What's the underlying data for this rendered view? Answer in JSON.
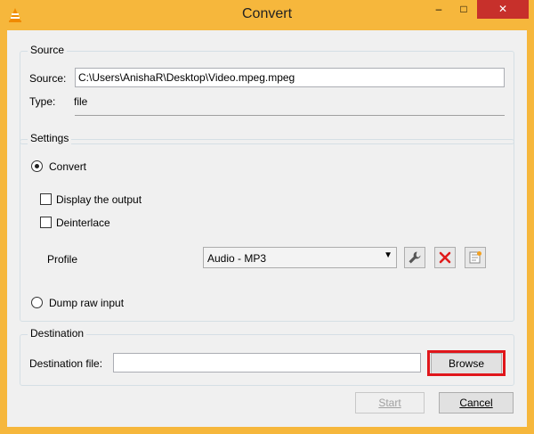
{
  "window": {
    "title": "Convert",
    "minimize_glyph": "–",
    "maximize_glyph": "□",
    "close_glyph": "✕",
    "icon": "vlc-cone-icon"
  },
  "source": {
    "group_title": "Source",
    "source_label": "Source:",
    "source_value": "C:\\Users\\AnishaR\\Desktop\\Video.mpeg.mpeg",
    "type_label": "Type:",
    "type_value": "file"
  },
  "settings": {
    "group_title": "Settings",
    "convert_label": "Convert",
    "convert_selected": true,
    "display_output_label": "Display the output",
    "display_output_checked": false,
    "deinterlace_label": "Deinterlace",
    "deinterlace_checked": false,
    "profile_label": "Profile",
    "profile_value": "Audio - MP3",
    "dump_raw_label": "Dump raw input",
    "dump_raw_selected": false,
    "icons": [
      "wrench-icon",
      "delete-icon",
      "new-profile-icon"
    ]
  },
  "destination": {
    "group_title": "Destination",
    "file_label": "Destination file:",
    "file_value": "",
    "browse_label": "Browse"
  },
  "footer": {
    "start_label": "Start",
    "start_enabled": false,
    "cancel_label": "Cancel"
  },
  "colors": {
    "frame": "#f6b73c",
    "close_button": "#c7302b",
    "highlight": "#e0161b"
  }
}
